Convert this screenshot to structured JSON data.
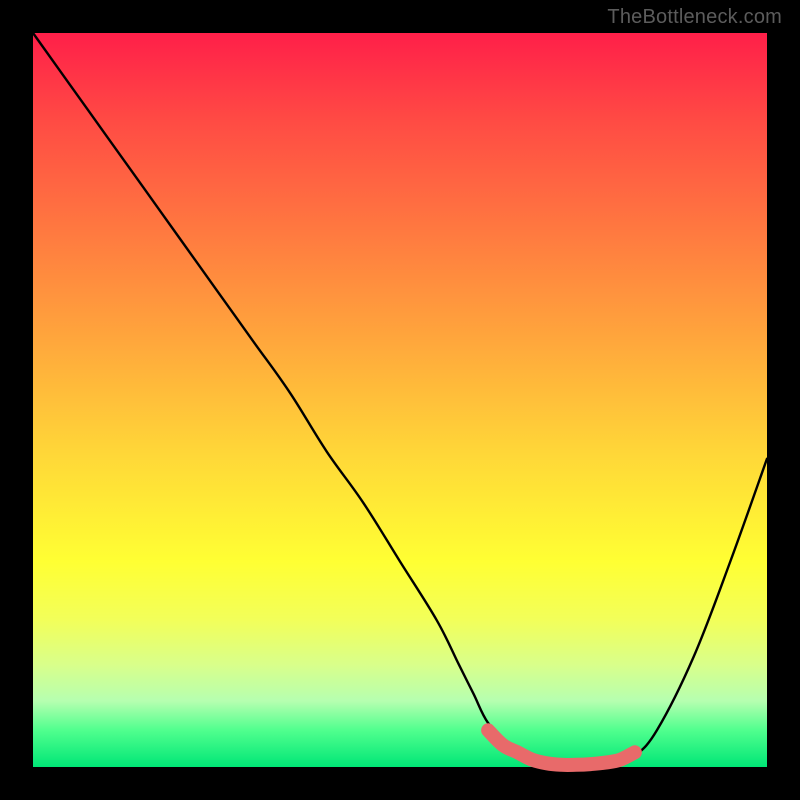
{
  "attribution": "TheBottleneck.com",
  "colors": {
    "frame": "#000000",
    "curve": "#000000",
    "marker": "#e86a6a",
    "gradient_top": "#ff1f49",
    "gradient_bottom": "#00e676"
  },
  "chart_data": {
    "type": "line",
    "title": "",
    "xlabel": "",
    "ylabel": "",
    "xlim": [
      0,
      100
    ],
    "ylim": [
      0,
      100
    ],
    "grid": false,
    "legend": false,
    "note": "Values estimated from pixel positions; y = 100 at top, 0 at bottom of gradient.",
    "series": [
      {
        "name": "bottleneck-curve",
        "x": [
          0,
          5,
          10,
          15,
          20,
          25,
          30,
          35,
          40,
          45,
          50,
          55,
          58,
          60,
          62,
          65,
          68,
          72,
          76,
          80,
          82,
          85,
          90,
          95,
          100
        ],
        "y": [
          100,
          93,
          86,
          79,
          72,
          65,
          58,
          51,
          43,
          36,
          28,
          20,
          14,
          10,
          6,
          3,
          1,
          0,
          0,
          0.5,
          1.5,
          5,
          15,
          28,
          42
        ]
      }
    ],
    "markers": {
      "name": "optimal-range",
      "x": [
        62,
        64,
        66,
        68,
        70,
        72,
        74,
        76,
        78,
        80,
        82
      ],
      "y": [
        5,
        3,
        2,
        1,
        0.5,
        0.3,
        0.3,
        0.4,
        0.6,
        1,
        2
      ]
    }
  }
}
